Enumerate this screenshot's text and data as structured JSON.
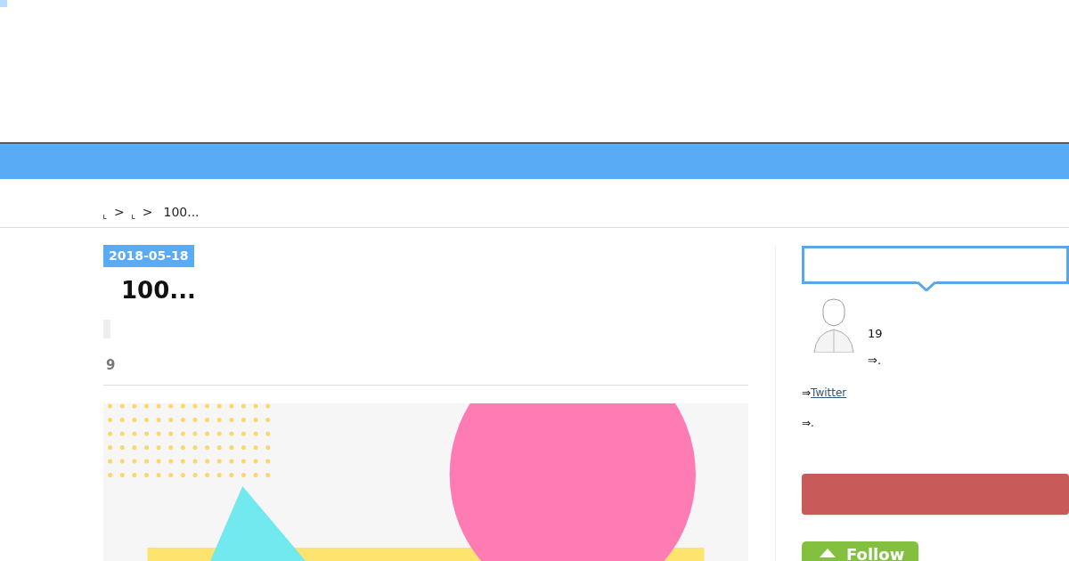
{
  "breadcrumb": {
    "separators": [
      ">",
      ">"
    ],
    "current": "100..."
  },
  "article": {
    "date": "2018-05-18",
    "title": "100...",
    "count": "9"
  },
  "sidebar": {
    "profile": {
      "lines": [
        "19",
        "⇒."
      ],
      "link_prefix": "⇒",
      "link": "Twitter",
      "note": "⇒."
    },
    "follow_button": "Follow"
  }
}
